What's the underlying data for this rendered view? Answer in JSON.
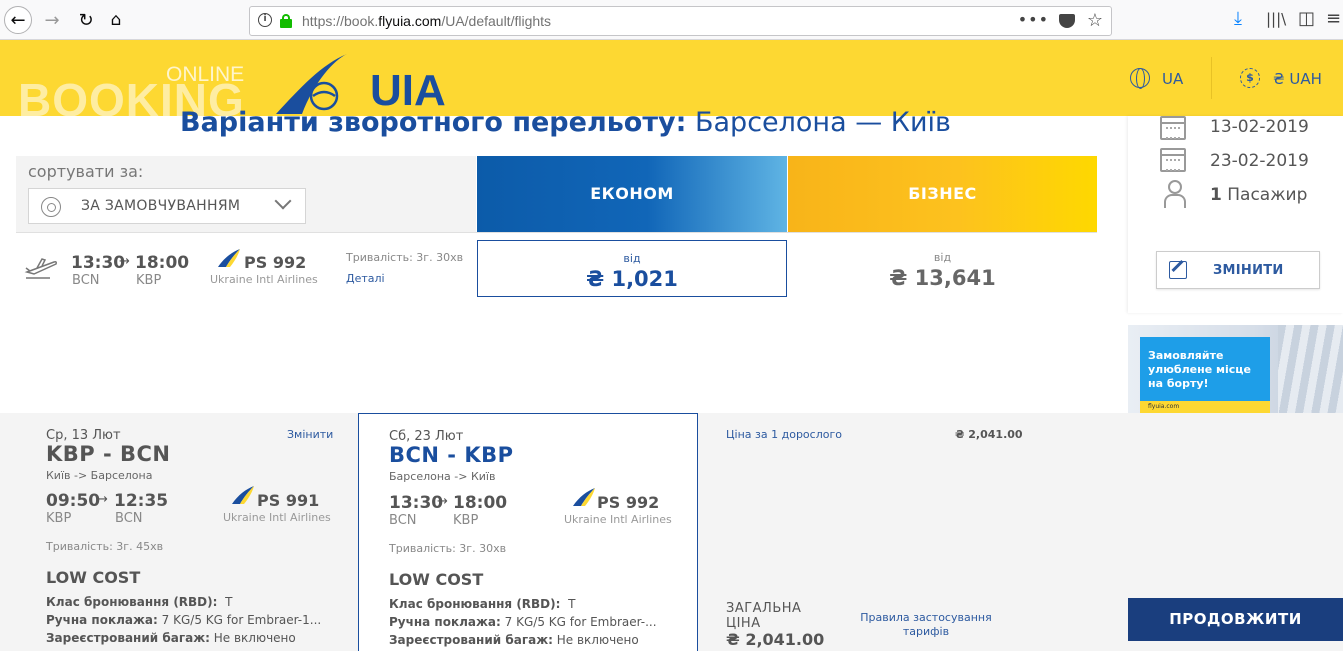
{
  "browser": {
    "url_prefix": "https://book.",
    "url_domain": "flyuia.com",
    "url_path": "/UA/default/flights"
  },
  "header": {
    "booking_text": "BOOKING",
    "online_text": "ONLINE",
    "logo_text": "UIA",
    "language": "UA",
    "currency": "₴ UAH",
    "brand_color": "#fdd832",
    "accent_color": "#1a4e9e"
  },
  "title": {
    "bold": "Варіанти зворотного перельоту:",
    "route": "Барселона — Київ"
  },
  "sort": {
    "label": "сортувати за:",
    "selected": "ЗА ЗАМОВЧУВАННЯМ"
  },
  "fares": {
    "economy": "ЕКОНОМ",
    "business": "БІЗНЕС"
  },
  "flight": {
    "dep_time": "13:30",
    "arr_time": "18:00",
    "dep_code": "BCN",
    "arr_code": "KBP",
    "number": "PS 992",
    "airline": "Ukraine Intl Airlines",
    "duration": "Тривалість: 3г. 30хв",
    "details": "Деталі",
    "economy_from": "від",
    "economy_price": "₴ 1,021",
    "business_from": "від",
    "business_price": "₴ 13,641"
  },
  "summary": {
    "date_out": "13-02-2019",
    "date_in": "23-02-2019",
    "passengers_count": "1",
    "passengers_label": "Пасажир",
    "change_button": "ЗМІНИТИ"
  },
  "ad": {
    "text_line1": "Замовляйте",
    "text_line2": "улюблене місце",
    "text_line3": "на борту!",
    "domain": "flyuia.com"
  },
  "cart": {
    "outbound": {
      "date": "Ср, 13 Лют",
      "change": "Змінити",
      "route": "KBP - BCN",
      "cities": "Київ -> Барселона",
      "dep_time": "09:50",
      "arr_time": "12:35",
      "dep_code": "KBP",
      "arr_code": "BCN",
      "number": "PS 991",
      "airline": "Ukraine Intl Airlines",
      "duration": "Тривалість: 3г. 45хв",
      "class": "LOW COST",
      "rbd_label": "Клас бронювання (RBD):",
      "rbd_value": "T",
      "hand_label": "Ручна поклажа:",
      "hand_value": "7 KG/5 KG for Embraer-1...",
      "bag_label": "Зареєстрований багаж:",
      "bag_value": "Не включено"
    },
    "inbound": {
      "date": "Сб, 23 Лют",
      "route": "BCN - KBP",
      "cities": "Барселона -> Київ",
      "dep_time": "13:30",
      "arr_time": "18:00",
      "dep_code": "BCN",
      "arr_code": "KBP",
      "number": "PS 992",
      "airline": "Ukraine Intl Airlines",
      "duration": "Тривалість: 3г. 30хв",
      "class": "LOW COST",
      "rbd_label": "Клас бронювання (RBD):",
      "rbd_value": "T",
      "hand_label": "Ручна поклажа:",
      "hand_value": "7 KG/5 KG for Embraer-...",
      "bag_label": "Зареєстрований багаж:",
      "bag_value": "Не включено"
    },
    "price_per_adult_label": "Ціна за 1 дорослого",
    "price_per_adult_value": "₴ 2,041.00",
    "total_label": "ЗАГАЛЬНА ЦІНА",
    "total_value": "₴ 2,041.00",
    "rules_link": "Правила застосування тарифів",
    "proceed": "ПРОДОВЖИТИ"
  }
}
